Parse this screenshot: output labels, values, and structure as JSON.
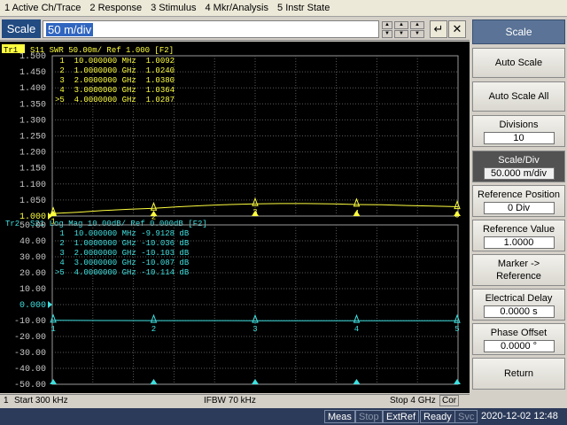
{
  "menu": [
    "1 Active Ch/Trace",
    "2 Response",
    "3 Stimulus",
    "4 Mkr/Analysis",
    "5 Instr State"
  ],
  "entry": {
    "label": "Scale",
    "value": "50 m/div"
  },
  "softkeys": {
    "title": "Scale",
    "auto_scale": "Auto Scale",
    "auto_scale_all": "Auto Scale All",
    "divisions_label": "Divisions",
    "divisions_value": "10",
    "scale_div_label": "Scale/Div",
    "scale_div_value": "50.000 m/div",
    "ref_pos_label": "Reference Position",
    "ref_pos_value": "0 Div",
    "ref_val_label": "Reference Value",
    "ref_val_value": "1.0000",
    "marker_ref_line1": "Marker ->",
    "marker_ref_line2": "Reference",
    "elec_delay_label": "Electrical Delay",
    "elec_delay_value": "0.0000 s",
    "phase_offset_label": "Phase Offset",
    "phase_offset_value": "0.0000 °",
    "return": "Return"
  },
  "status1": {
    "channel": "1",
    "start": "Start 300 kHz",
    "ifbw": "IFBW 70 kHz",
    "stop": "Stop 4 GHz",
    "cor": "Cor"
  },
  "status2": {
    "meas": "Meas",
    "stop": "Stop",
    "extref": "ExtRef",
    "ready": "Ready",
    "svc": "Svc",
    "datetime": "2020-12-02 12:48"
  },
  "chart_data": [
    {
      "type": "line",
      "trace_tag": "Tr1",
      "header": "S11  SWR 50.00m/ Ref 1.000 [F2]",
      "color": "#ffff40",
      "yticks": [
        "1.500",
        "1.450",
        "1.400",
        "1.350",
        "1.300",
        "1.250",
        "1.200",
        "1.150",
        "1.100",
        "1.050",
        "1.000"
      ],
      "ylim": [
        1.0,
        1.5
      ],
      "xlim": [
        0.0003,
        4.0
      ],
      "markers": [
        {
          "id": "1",
          "line": " 1  10.000000 MHz  1.0092",
          "x": 0.01,
          "y": 1.0092
        },
        {
          "id": "2",
          "line": " 2  1.0000000 GHz  1.0240",
          "x": 1.0,
          "y": 1.024
        },
        {
          "id": "3",
          "line": " 3  2.0000000 GHz  1.0380",
          "x": 2.0,
          "y": 1.038
        },
        {
          "id": "4",
          "line": " 4  3.0000000 GHz  1.0364",
          "x": 3.0,
          "y": 1.0364
        },
        {
          "id": "5",
          "line": ">5  4.0000000 GHz  1.0287",
          "x": 4.0,
          "y": 1.0287
        }
      ],
      "x": [
        0.0003,
        0.25,
        0.5,
        0.75,
        1.0,
        1.25,
        1.5,
        1.75,
        2.0,
        2.25,
        2.5,
        2.75,
        3.0,
        3.25,
        3.5,
        3.75,
        4.0
      ],
      "y": [
        1.008,
        1.012,
        1.017,
        1.021,
        1.024,
        1.029,
        1.033,
        1.036,
        1.038,
        1.039,
        1.039,
        1.038,
        1.036,
        1.035,
        1.033,
        1.031,
        1.029
      ]
    },
    {
      "type": "line",
      "trace_tag": "Tr2",
      "header": "S21  Log Mag 10.00dB/ Ref 0.000dB [F2]",
      "color": "#40e0e0",
      "yticks": [
        "50.00",
        "40.00",
        "30.00",
        "20.00",
        "10.00",
        "0.000",
        "-10.00",
        "-20.00",
        "-30.00",
        "-40.00",
        "-50.00"
      ],
      "ylim": [
        -50,
        50
      ],
      "xlim": [
        0.0003,
        4.0
      ],
      "markers": [
        {
          "id": "1",
          "line": " 1  10.000000 MHz -9.9128 dB",
          "x": 0.01,
          "y": -9.9128
        },
        {
          "id": "2",
          "line": " 2  1.0000000 GHz -10.036 dB",
          "x": 1.0,
          "y": -10.036
        },
        {
          "id": "3",
          "line": " 3  2.0000000 GHz -10.103 dB",
          "x": 2.0,
          "y": -10.103
        },
        {
          "id": "4",
          "line": " 4  3.0000000 GHz -10.087 dB",
          "x": 3.0,
          "y": -10.087
        },
        {
          "id": "5",
          "line": ">5  4.0000000 GHz -10.114 dB",
          "x": 4.0,
          "y": -10.114
        }
      ],
      "x": [
        0.0003,
        0.5,
        1.0,
        1.5,
        2.0,
        2.5,
        3.0,
        3.5,
        4.0
      ],
      "y": [
        -9.91,
        -9.98,
        -10.04,
        -10.07,
        -10.1,
        -10.09,
        -10.09,
        -10.1,
        -10.11
      ]
    }
  ]
}
